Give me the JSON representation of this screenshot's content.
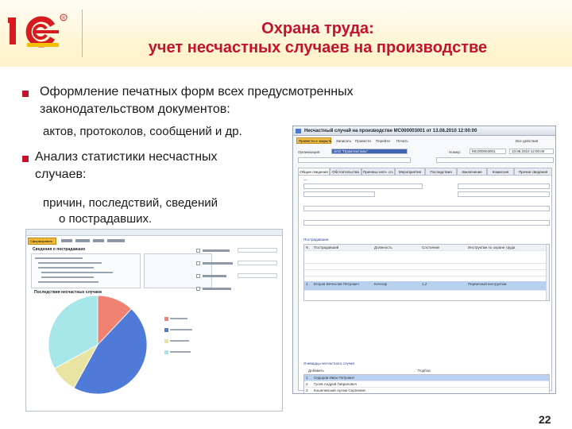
{
  "header": {
    "logo_text": "1С",
    "title_line1": "Охрана труда:",
    "title_line2": "учет несчастных случаев на производстве"
  },
  "bullets": [
    {
      "text_line1": "Оформление печатных форм всех предусмотренных",
      "text_line2": "законодательством документов:",
      "sub": "актов, протоколов, сообщений и др."
    },
    {
      "text_line1": "Анализ статистики несчастных",
      "text_line2": "случаев:",
      "sub_line1": "причин, последствий, сведений",
      "sub_line2": "о пострадавших."
    }
  ],
  "page_number": "22",
  "colors": {
    "accent": "#c2122c",
    "header_bg": "#fff4d3"
  },
  "screenshot1": {
    "generate_button": "Сформировать",
    "heading": "Сведения о пострадавших",
    "chart_title": "Последствия несчастных случаев",
    "chart_data": {
      "type": "pie",
      "values": [
        12,
        46,
        9,
        33
      ],
      "colors": [
        "#f08272",
        "#4f7ad8",
        "#eae4a2",
        "#a7e7ea"
      ]
    }
  },
  "screenshot2": {
    "window_title": "Несчастный случай на производстве МС000003001 от 13.08.2010 12:00:00",
    "toolbar_buttons": [
      "Провести и закрыть",
      "Записать",
      "Провести",
      "Перейти",
      "Печать",
      "Все действия"
    ],
    "org_label": "Организация:",
    "org_value": "ЗАО \"Промтекстиль\"",
    "number_label": "Номер:",
    "number_value": "МС000003001",
    "date_value": "13.08.2010 12:00:00",
    "tabs": [
      "Общие сведения",
      "Обстоятельства",
      "Причины несч. сл.",
      "Мероприятия",
      "Последствия",
      "Заключение",
      "Комиссия",
      "Прочие сведения"
    ],
    "section_people": "Пострадавшие:",
    "grid_people_headers": [
      "N",
      "Пострадавший",
      "Должность",
      "Состояние",
      "Инструктаж по охране труда"
    ],
    "grid_people_rows": [
      [
        "1",
        "Егоров Вячеслав Петрович",
        "Кочегар",
        "1,2",
        "Первичный инструктаж"
      ]
    ],
    "section_witnesses": "Очевидцы несчастного случая",
    "witness_toolbar": [
      "Добавить",
      "Подбор"
    ],
    "grid_witness_rows": [
      [
        "1",
        "Сидоров Иван Петрович"
      ],
      [
        "2",
        "Гусев Андрей Гаврилович"
      ],
      [
        "3",
        "Кошелевский Артем Сергеевич"
      ]
    ]
  }
}
